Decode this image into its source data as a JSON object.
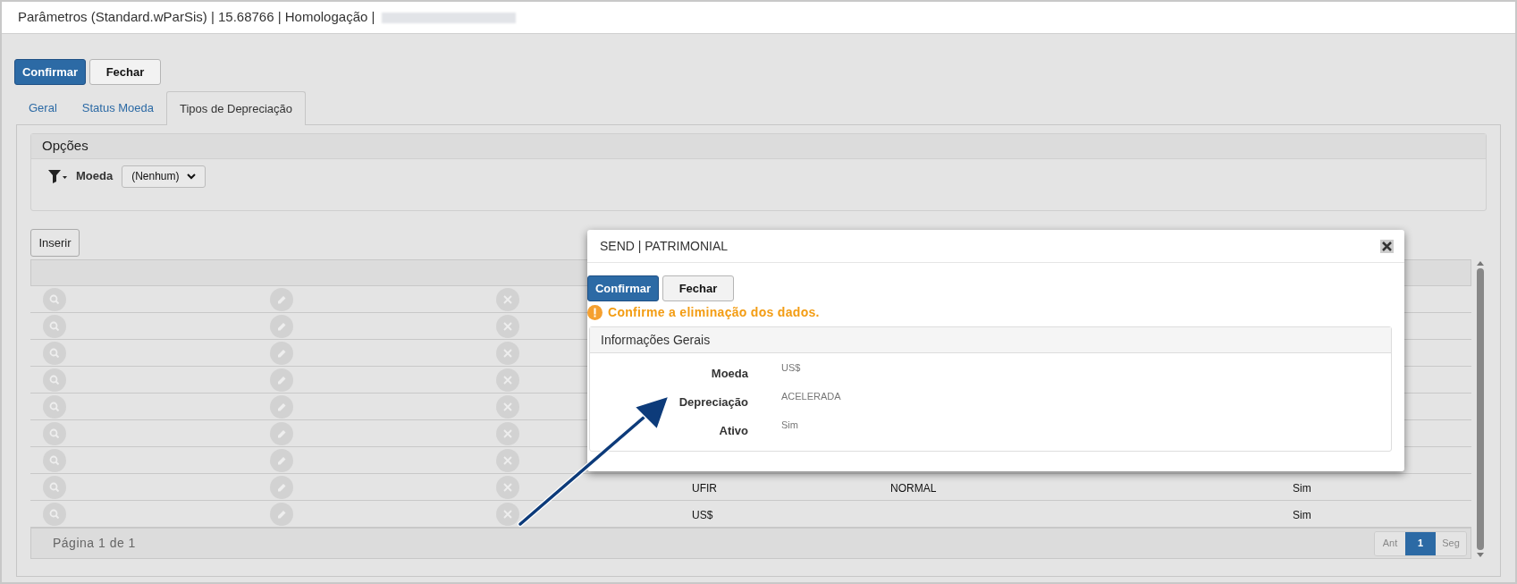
{
  "window": {
    "title": "Parâmetros (Standard.wParSis) | 15.68766 | Homologação |"
  },
  "actions": [
    "Confirmar",
    "Fechar"
  ],
  "tabs": [
    {
      "label": "Geral",
      "selected": false
    },
    {
      "label": "Status Moeda",
      "selected": false
    },
    {
      "label": "Tipos de Depreciação",
      "selected": true
    }
  ],
  "options": {
    "title": "Opções",
    "filter_label": "Moeda",
    "select_value": "(Nenhum)"
  },
  "insert_button": "Inserir",
  "table": {
    "rows": [
      {
        "cells": []
      },
      {
        "cells": []
      },
      {
        "cells": []
      },
      {
        "cells": []
      },
      {
        "cells": []
      },
      {
        "cells": []
      },
      {
        "cells": []
      },
      {
        "cells": [
          "UFIR",
          "NORMAL",
          "Sim"
        ]
      },
      {
        "cells": [
          "US$",
          "",
          "Sim"
        ]
      }
    ]
  },
  "pager": {
    "label": "Página 1 de 1",
    "pages": [
      {
        "label": "Ant",
        "selected": false
      },
      {
        "label": "1",
        "selected": true
      },
      {
        "label": "Seg",
        "selected": false
      }
    ]
  },
  "dialog": {
    "title": "SEND | PATRIMONIAL",
    "buttons": [
      "Confirmar",
      "Fechar"
    ],
    "warning": "Confirme a eliminação dos dados.",
    "section": "Informações Gerais",
    "fields": [
      {
        "label": "Moeda",
        "value": "US$"
      },
      {
        "label": "Depreciação",
        "value": "ACELERADA"
      },
      {
        "label": "Ativo",
        "value": "Sim"
      }
    ]
  }
}
